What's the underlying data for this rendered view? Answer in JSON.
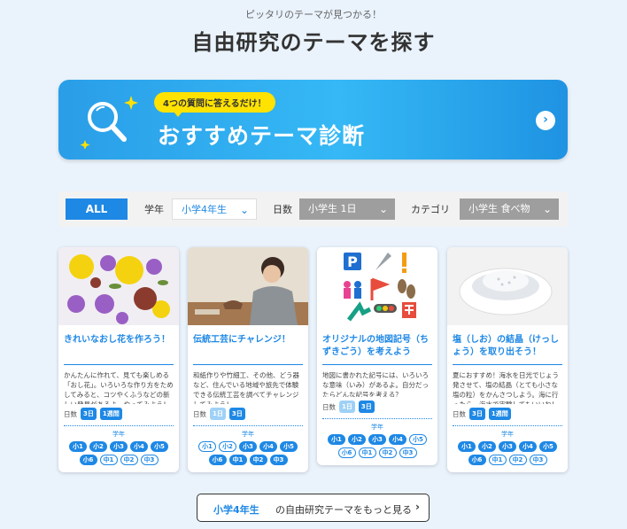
{
  "header": {
    "tagline": "ピッタリのテーマが見つかる！",
    "title": "自由研究のテーマを探す"
  },
  "banner": {
    "badge": "4つの質問に答えるだけ！",
    "title": "おすすめテーマ診断",
    "arrow": "›"
  },
  "filters": {
    "all_label": "ALL",
    "grade_label": "学年",
    "grade_value": "小学4年生",
    "days_label": "日数",
    "days_value": "小学生 1日",
    "category_label": "カテゴリ",
    "category_value": "小学生 食べ物",
    "chevron": "⌄"
  },
  "cards": [
    {
      "title": "きれいなおし花を作ろう！",
      "desc": "かんたんに作れて、見ても楽しめる「おし花」。いろいろな作り方をためしてみると、コツやくふうなどの新しい発見があるよ。やってみよう！",
      "days_label": "日数",
      "days": [
        "3日",
        "1週間"
      ],
      "grade_label": "学年",
      "grades": [
        "小1",
        "小2",
        "小3",
        "小4",
        "小5",
        "小6",
        "中1",
        "中2",
        "中3"
      ]
    },
    {
      "title": "伝統工芸にチャレンジ！",
      "desc": "和紙作りや竹細工、その他、どう器など、住んでいる地域や旅先で体験できる伝統工芸を調べてチャレンジしてみよう！",
      "days_label": "日数",
      "days": [
        "1日",
        "3日"
      ],
      "grade_label": "学年",
      "grades": [
        "小1",
        "小2",
        "小3",
        "小4",
        "小5",
        "小6",
        "中1",
        "中2",
        "中3"
      ]
    },
    {
      "title": "オリジナルの地図記号（ちずきごう）を考えよう",
      "desc": "地図に書かれた記号には、いろいろな意味（いみ）があるよ。自分だったらどんな記号を考える？",
      "days_label": "日数",
      "days": [
        "1日",
        "3日"
      ],
      "grade_label": "学年",
      "grades": [
        "小1",
        "小2",
        "小3",
        "小4",
        "小5",
        "小6",
        "中1",
        "中2",
        "中3"
      ]
    },
    {
      "title": "塩（しお）の結晶（けっしょう）を取り出そう！",
      "desc": "夏におすすめ！海水を日光でじょう発させて、塩の結晶（とても小さな塩の粒）をかんさつしよう。海に行ったら、海水で実験してもいいね！",
      "days_label": "日数",
      "days": [
        "3日",
        "1週間"
      ],
      "grade_label": "学年",
      "grades": [
        "小1",
        "小2",
        "小3",
        "小4",
        "小5",
        "小6",
        "中1",
        "中2",
        "中3"
      ]
    }
  ],
  "more_button": {
    "grade": "小学4年生",
    "text": "の自由研究テーマをもっと見る",
    "chevron": "›"
  },
  "colors": {
    "accent": "#1e88e5",
    "banner": "#2a9ee8",
    "badge": "#ffe200",
    "background": "#eaf3fc"
  }
}
